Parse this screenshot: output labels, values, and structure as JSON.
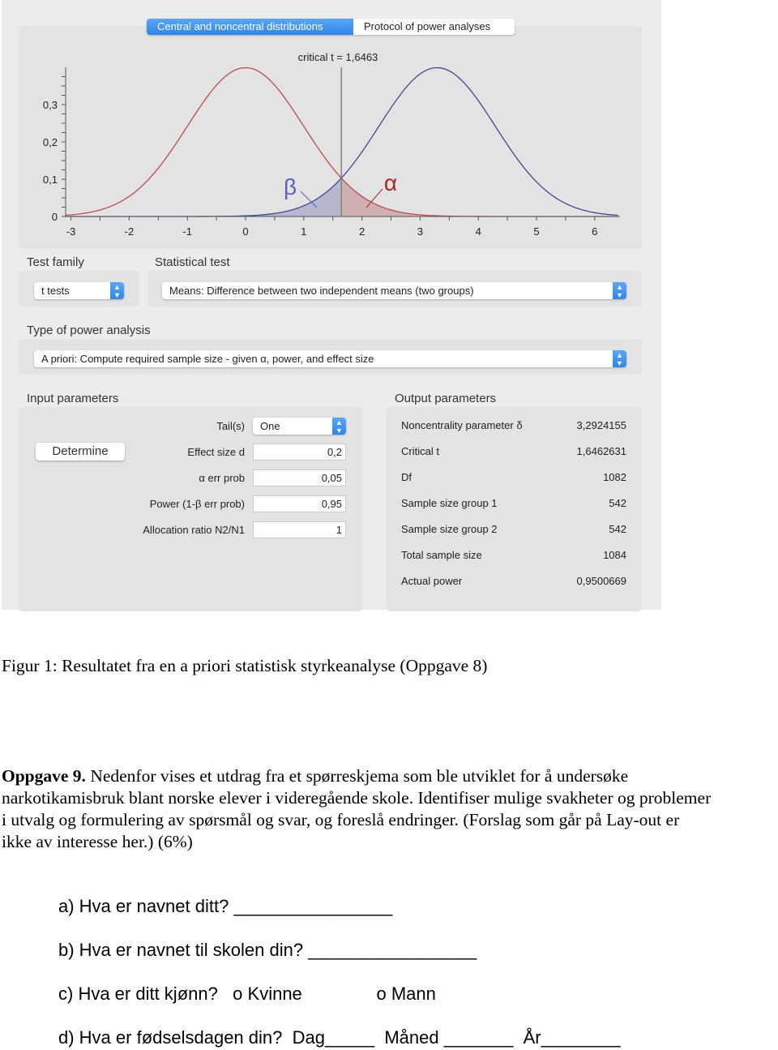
{
  "tabs": [
    {
      "label": "Central and noncentral distributions",
      "active": true
    },
    {
      "label": "Protocol of power analyses",
      "active": false
    }
  ],
  "chart_data": {
    "type": "line",
    "title": "critical t = 1,6463",
    "x_ticks": [
      "-3",
      "-2",
      "-1",
      "0",
      "1",
      "2",
      "3",
      "4",
      "5",
      "6"
    ],
    "y_ticks": [
      "0",
      "0,1",
      "0,2",
      "0,3"
    ],
    "xlim": [
      -3.1,
      6.4
    ],
    "ylim": [
      0,
      0.4
    ],
    "critical_t": 1.6463,
    "series": [
      {
        "name": "β",
        "mean": 0,
        "color": "#b5504b",
        "shade": "right of critical t"
      },
      {
        "name": "α",
        "mean": 3.2924155,
        "color": "#3d4a8c",
        "shade": "left of critical t"
      }
    ],
    "annotations": [
      "β",
      "α"
    ],
    "colors": {
      "central": "#b5504b",
      "noncentral": "#3d4a8c"
    }
  },
  "test_family": {
    "label": "Test family",
    "value": "t tests"
  },
  "statistical_test": {
    "label": "Statistical test",
    "value": "Means: Difference between two independent means (two groups)"
  },
  "power_analysis": {
    "label": "Type of power analysis",
    "value": "A priori: Compute required sample size - given α, power, and effect size"
  },
  "input": {
    "label": "Input parameters",
    "determine": "Determine",
    "tails_label": "Tail(s)",
    "tails_value": "One",
    "rows": [
      {
        "label": "Effect size d",
        "value": "0,2"
      },
      {
        "label": "α err prob",
        "value": "0,05"
      },
      {
        "label": "Power (1-β err prob)",
        "value": "0,95"
      },
      {
        "label": "Allocation ratio N2/N1",
        "value": "1"
      }
    ]
  },
  "output": {
    "label": "Output parameters",
    "rows": [
      {
        "label": "Noncentrality parameter δ",
        "value": "3,2924155"
      },
      {
        "label": "Critical t",
        "value": "1,6462631"
      },
      {
        "label": "Df",
        "value": "1082"
      },
      {
        "label": "Sample size group 1",
        "value": "542"
      },
      {
        "label": "Sample size group 2",
        "value": "542"
      },
      {
        "label": "Total sample size",
        "value": "1084"
      },
      {
        "label": "Actual power",
        "value": "0,9500669"
      }
    ]
  },
  "caption": "Figur 1: Resultatet fra en a priori statistisk styrkeanalyse (Oppgave 8)",
  "task": {
    "title": "Oppgave 9.",
    "lines": [
      " Nedenfor vises et utdrag fra et spørreskjema som ble utviklet for å undersøke",
      "narkotikamisbruk blant norske elever i videregående skole. Identifiser mulige svakheter og problemer",
      "i utvalg og formulering av spørsmål og svar, og foreslå endringer. (Forslag som går på Lay-out er",
      "ikke av interesse her.) (6%)"
    ]
  },
  "questions": [
    "a) Hva er navnet ditt? ________________",
    "b) Hva er navnet til skolen din? _________________",
    "c) Hva er ditt kjønn?   o Kvinne               o Mann",
    "d) Hva er fødselsdagen din?  Dag_____  Måned _______  År________"
  ]
}
